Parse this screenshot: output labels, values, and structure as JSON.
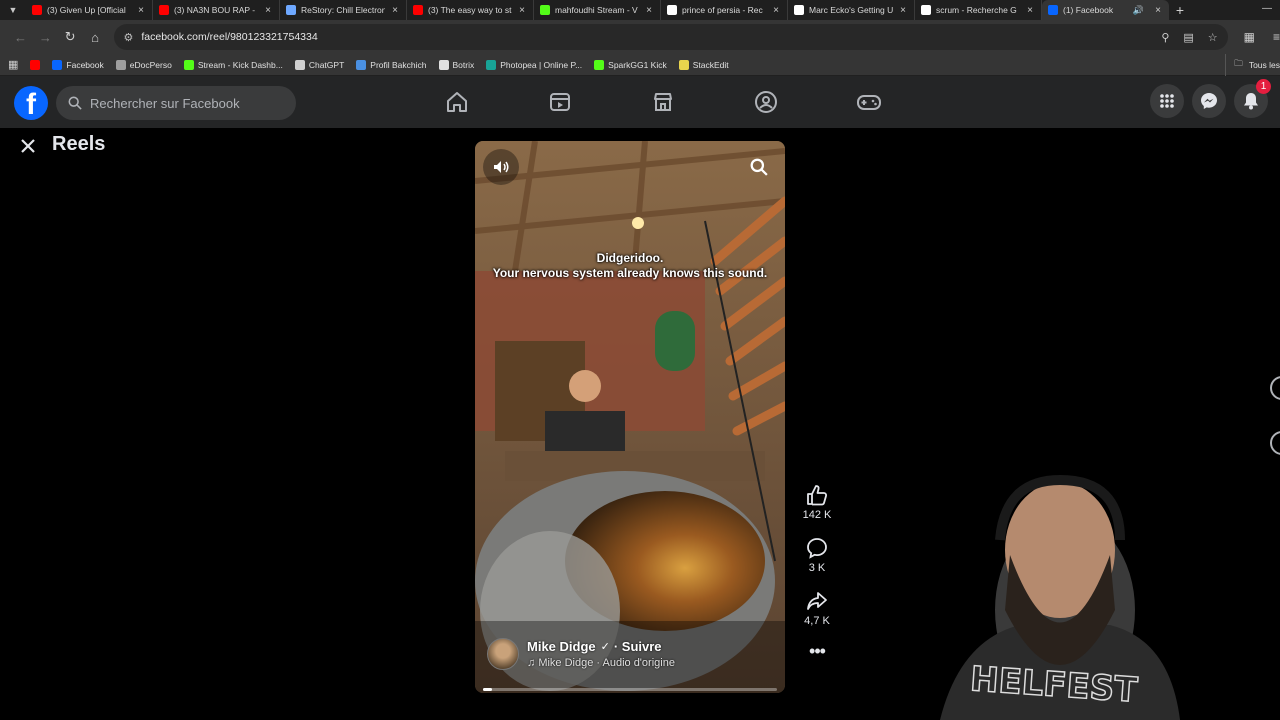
{
  "browser": {
    "tabs": [
      {
        "title": "(3) Given Up [Official",
        "color": "#ff0000"
      },
      {
        "title": "(3) NA3N BOU RAP -",
        "color": "#ff0000"
      },
      {
        "title": "ReStory: Chill Electron",
        "color": "#6ea8ff"
      },
      {
        "title": "(3) The easy way to st",
        "color": "#ff0000"
      },
      {
        "title": "mahfoudhi Stream - V",
        "color": "#53fc18"
      },
      {
        "title": "prince of persia - Rec",
        "color": "#ffffff"
      },
      {
        "title": "Marc Ecko's Getting U",
        "color": "#ffffff"
      },
      {
        "title": "scrum - Recherche G",
        "color": "#ffffff"
      },
      {
        "title": "(1) Facebook",
        "color": "#0866ff",
        "active": true
      }
    ],
    "url": "facebook.com/reel/980123321754334",
    "bookmarks": [
      {
        "label": "",
        "color": "#ff0000"
      },
      {
        "label": "Facebook",
        "color": "#0866ff"
      },
      {
        "label": "eDocPerso",
        "color": "#9e9e9e"
      },
      {
        "label": "Stream - Kick Dashb...",
        "color": "#53fc18"
      },
      {
        "label": "ChatGPT",
        "color": "#d0d0d0"
      },
      {
        "label": "Profil Bakchich",
        "color": "#4a90e2"
      },
      {
        "label": "Botrix",
        "color": "#e0e0e0"
      },
      {
        "label": "Photopea | Online P...",
        "color": "#18a497"
      },
      {
        "label": "SparkGG1 Kick",
        "color": "#53fc18"
      },
      {
        "label": "StackEdit",
        "color": "#e8d44d"
      }
    ],
    "bookmarks_right": "Tous les"
  },
  "facebook": {
    "search_placeholder": "Rechercher sur Facebook",
    "notifications_count": "1",
    "page_title": "Reels"
  },
  "reel": {
    "caption_line1": "Didgeridoo.",
    "caption_line2": "Your nervous system already knows this sound.",
    "author": "Mike Didge",
    "follow": "· Suivre",
    "audio": "Mike Didge · Audio d'origine",
    "progress": 0.03,
    "likes": "142 K",
    "comments": "3 K",
    "shares": "4,7 K"
  }
}
